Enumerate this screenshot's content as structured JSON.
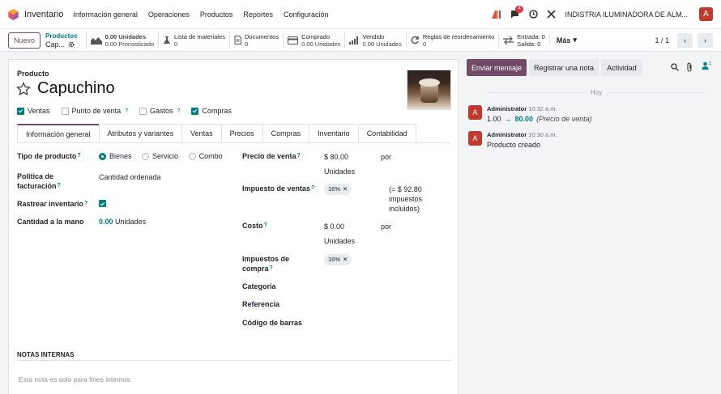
{
  "nav": {
    "app_name": "Inventario",
    "menu": [
      "Información general",
      "Operaciones",
      "Productos",
      "Reportes",
      "Configuración"
    ],
    "messages_badge": "4",
    "company": "INDISTRIA ILUMINADORA DE ALM...",
    "avatar_letter": "A"
  },
  "control": {
    "new_label": "Nuevo",
    "breadcrumb_parent": "Productos",
    "breadcrumb_current": "Cap...",
    "smart_buttons": {
      "forecast": {
        "line1": "0.00 Unidades",
        "line2": "0.00 Pronosticado"
      },
      "bom": {
        "line1": "Lista de materiales",
        "line2": "0"
      },
      "documents": {
        "line1": "Documentos",
        "line2": "0"
      },
      "purchased": {
        "line1": "Comprado",
        "line2": "0.00 Unidades"
      },
      "sold": {
        "line1": "Vendido",
        "line2": "0.00 Unidades"
      },
      "reorder": {
        "line1": "Reglas de reordenamiento",
        "line2": "0"
      },
      "moves": {
        "line1": "Entrada: 0",
        "line2": "Salida: 0"
      }
    },
    "more_label": "Más",
    "pager": "1 / 1"
  },
  "form": {
    "label_producto": "Producto",
    "name": "Capuchino",
    "checks": {
      "ventas": "Ventas",
      "pos": "Punto de venta",
      "gastos": "Gastos",
      "compras": "Compras"
    },
    "tabs": [
      "Información general",
      "Atributos y variantes",
      "Ventas",
      "Precios",
      "Compras",
      "Inventario",
      "Contabilidad"
    ],
    "fields": {
      "tipo_label": "Tipo de producto",
      "tipo_options": [
        "Bienes",
        "Servicio",
        "Combo"
      ],
      "politica_label_1": "Política de",
      "politica_label_2": "facturación",
      "politica_value": "Cantidad ordenada",
      "rastrear_label": "Rastrear inventario",
      "cantidad_label": "Cantidad a la mano",
      "cantidad_value": "0.00",
      "cantidad_unit": "Unidades",
      "precio_label": "Precio de venta",
      "precio_value": "$ 80.00",
      "precio_per": "por",
      "precio_unit": "Unidades",
      "impuesto_venta_label": "Impuesto de ventas",
      "impuesto_venta_tag": "16%",
      "impuesto_incl_1": "(= $ 92.80",
      "impuesto_incl_2": "impuestos",
      "impuesto_incl_3": "incluidos)",
      "costo_label": "Costo",
      "costo_value": "$ 0.00",
      "costo_per": "por",
      "costo_unit": "Unidades",
      "impuesto_compra_label_1": "Impuestos de",
      "impuesto_compra_label_2": "compra",
      "impuesto_compra_tag": "16%",
      "categoria_label": "Categoría",
      "referencia_label": "Referencia",
      "codigo_label": "Código de barras"
    },
    "notes_title": "NOTAS INTERNAS",
    "notes_placeholder": "Esta nota es solo para fines internos."
  },
  "chatter": {
    "send_message": "Enviar mensaje",
    "log_note": "Registrar una nota",
    "activity": "Actividad",
    "followers_count": "1",
    "today_label": "Hoy",
    "messages": [
      {
        "avatar": "A",
        "author": "Administrator",
        "time": "10:32 a.m.",
        "old": "1.00",
        "new": "80.00",
        "field": "(Precio de venta)"
      },
      {
        "avatar": "A",
        "author": "Administrator",
        "time": "10:30 a.m.",
        "body": "Producto creado"
      }
    ]
  },
  "colors": {
    "brand": "#714b67",
    "accent": "#017e84"
  }
}
